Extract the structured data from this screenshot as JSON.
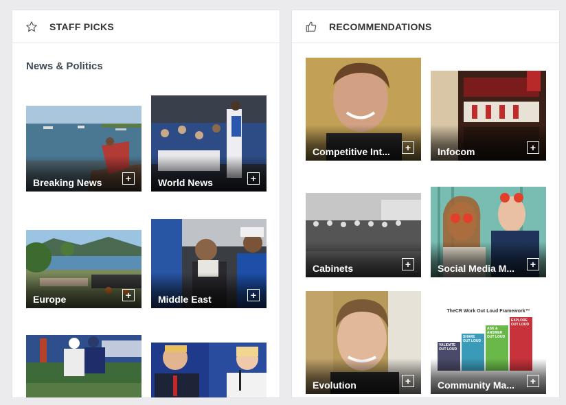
{
  "staff_picks": {
    "header_title": "STAFF PICKS",
    "header_icon": "star-icon",
    "section_title": "News & Politics",
    "tiles": [
      {
        "label": "Breaking News",
        "add": "+"
      },
      {
        "label": "World News",
        "add": "+"
      },
      {
        "label": "Europe",
        "add": "+"
      },
      {
        "label": "Middle East",
        "add": "+"
      },
      {
        "label": "",
        "add": ""
      },
      {
        "label": "",
        "add": ""
      }
    ]
  },
  "recommendations": {
    "header_title": "RECOMMENDATIONS",
    "header_icon": "thumbs-up-icon",
    "tiles": [
      {
        "label": "Competitive Int...",
        "add": "+"
      },
      {
        "label": "Infocom",
        "add": "+"
      },
      {
        "label": "Cabinets",
        "add": "+"
      },
      {
        "label": "Social Media M...",
        "add": "+"
      },
      {
        "label": "Evolution",
        "add": "+"
      },
      {
        "label": "Community Ma...",
        "add": "+"
      }
    ],
    "framework_image": {
      "title": "TheCR Work Out Loud Framework™",
      "steps": [
        "VALIDATE OUT LOUD",
        "SHARE OUT LOUD",
        "ASK & ANSWER OUT LOUD",
        "EXPLORE OUT LOUD"
      ]
    }
  },
  "colors": {
    "background": "#ebebee",
    "panel": "#ffffff",
    "text": "#333333"
  }
}
